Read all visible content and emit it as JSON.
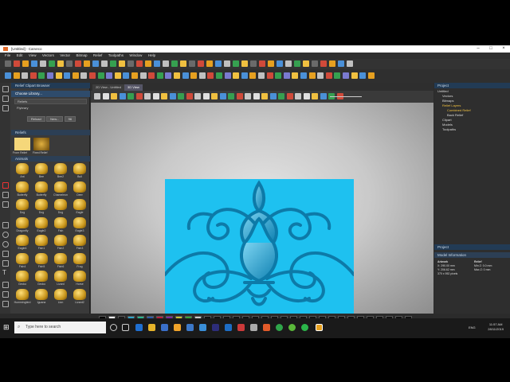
{
  "window": {
    "title": "[Untitled] - Carveco",
    "minimize_icon": "minimize-icon",
    "maximize_icon": "maximize-icon",
    "close_icon": "close-icon"
  },
  "menu": [
    "File",
    "Edit",
    "View",
    "Vectors",
    "Vector",
    "Bitmap",
    "Relief",
    "Toolpaths",
    "Window",
    "Help"
  ],
  "left_panel": {
    "header": "Relief Clipart Browser",
    "choose_library": "Choose Library...",
    "library_value": "Reliefs",
    "category": "Flybrary",
    "buttons": [
      "Reload",
      "New..."
    ],
    "size_value": "96",
    "section_reliefs": "Reliefs",
    "relief_items": [
      "From Relief",
      "Fixed Relief"
    ],
    "section_animals": "Animals",
    "animals": [
      "Ant",
      "Bee",
      "Bee2",
      "Bull",
      "Butterfly",
      "Butterfly",
      "Chameleon",
      "Deer",
      "Dog",
      "Dog",
      "Dog",
      "Eagle",
      "Dragonfly",
      "Eagle2",
      "Fish",
      "Eagle3",
      "Eagle4",
      "Fish1",
      "Fish2",
      "Fish3",
      "Fish4",
      "Fish5",
      "Fish6",
      "Frog",
      "Gecko",
      "Gecko",
      "Lizard",
      "Horse",
      "Hummingbird",
      "Iguana",
      "Lion",
      "Lizard2"
    ]
  },
  "view_tabs": [
    "2D View - Untitled",
    "3D View"
  ],
  "right_panel": {
    "project_header": "Project",
    "tree": [
      "Untitled",
      "Vectors",
      "Bitmaps",
      "Relief Layers",
      "Combined Relief",
      "Back Relief",
      "Clipart",
      "Models",
      "Toolpaths"
    ],
    "prop_header": "Project",
    "model_info_header": "Model Information",
    "artwork_label": "Artwork",
    "artwork_lines": [
      "X: 290.00 mm",
      "Y: 206.62 mm",
      "370 x 952 pixels"
    ],
    "relief_label": "Relief",
    "relief_lines": [
      "Min Z: 0.0 mm",
      "Max Z: 0 mm"
    ]
  },
  "palette_colors": [
    "#000000",
    "#ffffff",
    "#1a1a1a",
    "#2fa3c8",
    "#28b48c",
    "#2c5aa8",
    "#b81d3c",
    "#7a2aa0",
    "#c4c23a",
    "#3aa03a",
    "#c8c8c8"
  ],
  "status": {
    "coords": "X: 171.174  Y: -93.772",
    "zoom": "Z: 0.000",
    "size": "W: 0.000"
  },
  "taskbar": {
    "search_placeholder": "Type here to search",
    "time": "11:57 AM",
    "date": "28/11/2019",
    "lang": "ENG"
  },
  "colors": {
    "relief_fill": "#1ec1f0",
    "relief_gold": "#d8a63a",
    "panel_header": "#223b55"
  }
}
